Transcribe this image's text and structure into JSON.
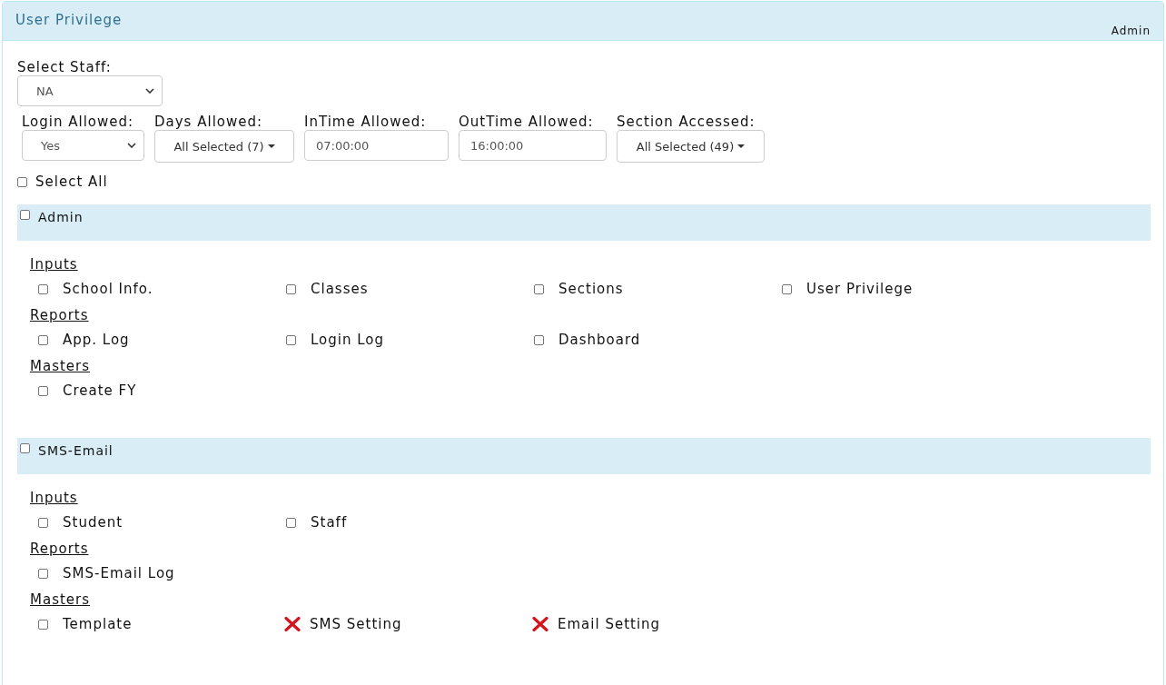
{
  "panel": {
    "title": "User Privilege",
    "user": "Admin"
  },
  "staff": {
    "label": "Select Staff:",
    "value": "NA"
  },
  "filters": [
    {
      "kind": "select",
      "label": "Login Allowed:",
      "value": "Yes"
    },
    {
      "kind": "multiselect",
      "label": "Days Allowed:",
      "value": "All Selected (7)"
    },
    {
      "kind": "text",
      "label": "InTime Allowed:",
      "value": "07:00:00"
    },
    {
      "kind": "text",
      "label": "OutTime Allowed:",
      "value": "16:00:00"
    },
    {
      "kind": "multiselect",
      "label": "Section Accessed:",
      "value": "All Selected (49)"
    }
  ],
  "select_all": {
    "label": "Select All",
    "checked": false
  },
  "modules": [
    {
      "name": "Admin",
      "checked": false,
      "groups": [
        {
          "title": "Inputs",
          "items": [
            {
              "kind": "checkbox",
              "label": "School Info.",
              "checked": false
            },
            {
              "kind": "checkbox",
              "label": "Classes",
              "checked": false
            },
            {
              "kind": "checkbox",
              "label": "Sections",
              "checked": false
            },
            {
              "kind": "checkbox",
              "label": "User Privilege",
              "checked": false
            }
          ]
        },
        {
          "title": "Reports",
          "items": [
            {
              "kind": "checkbox",
              "label": "App. Log",
              "checked": false
            },
            {
              "kind": "checkbox",
              "label": "Login Log",
              "checked": false
            },
            {
              "kind": "checkbox",
              "label": "Dashboard",
              "checked": false
            }
          ]
        },
        {
          "title": "Masters",
          "items": [
            {
              "kind": "checkbox",
              "label": "Create FY",
              "checked": false
            }
          ]
        }
      ]
    },
    {
      "name": "SMS-Email",
      "checked": false,
      "groups": [
        {
          "title": "Inputs",
          "items": [
            {
              "kind": "checkbox",
              "label": "Student",
              "checked": false
            },
            {
              "kind": "checkbox",
              "label": "Staff",
              "checked": false
            }
          ]
        },
        {
          "title": "Reports",
          "items": [
            {
              "kind": "checkbox",
              "label": "SMS-Email Log",
              "checked": false
            }
          ]
        },
        {
          "title": "Masters",
          "items": [
            {
              "kind": "checkbox",
              "label": "Template",
              "checked": false
            },
            {
              "kind": "unavailable",
              "label": "SMS Setting"
            },
            {
              "kind": "unavailable",
              "label": "Email Setting"
            }
          ]
        }
      ]
    }
  ]
}
